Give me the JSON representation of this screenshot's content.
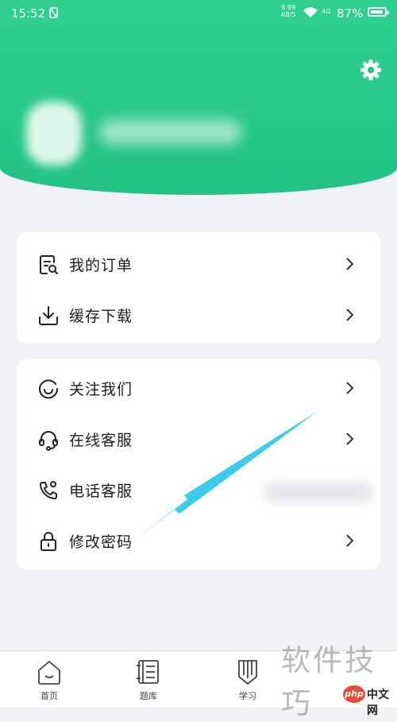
{
  "status_bar": {
    "time": "15:52",
    "speed_value": "6.99",
    "speed_unit": "KB/S",
    "signal_label": "4G",
    "battery": "87%"
  },
  "menu_group_1": [
    {
      "label": "我的订单",
      "icon": "order-icon"
    },
    {
      "label": "缓存下载",
      "icon": "download-icon"
    }
  ],
  "menu_group_2": [
    {
      "label": "关注我们",
      "icon": "follow-icon"
    },
    {
      "label": "在线客服",
      "icon": "headset-icon"
    },
    {
      "label": "电话客服",
      "icon": "phone-icon"
    },
    {
      "label": "修改密码",
      "icon": "lock-icon"
    }
  ],
  "tabs": [
    {
      "label": "首页",
      "icon": "home-icon"
    },
    {
      "label": "题库",
      "icon": "question-bank-icon"
    },
    {
      "label": "学习",
      "icon": "study-icon"
    }
  ],
  "watermark": "软件技巧",
  "badge": {
    "logo": "php",
    "text": "中文网"
  },
  "colors": {
    "brand_green": "#22c383",
    "arrow_blue": "#3ccbee",
    "background": "#f1f1f8"
  }
}
